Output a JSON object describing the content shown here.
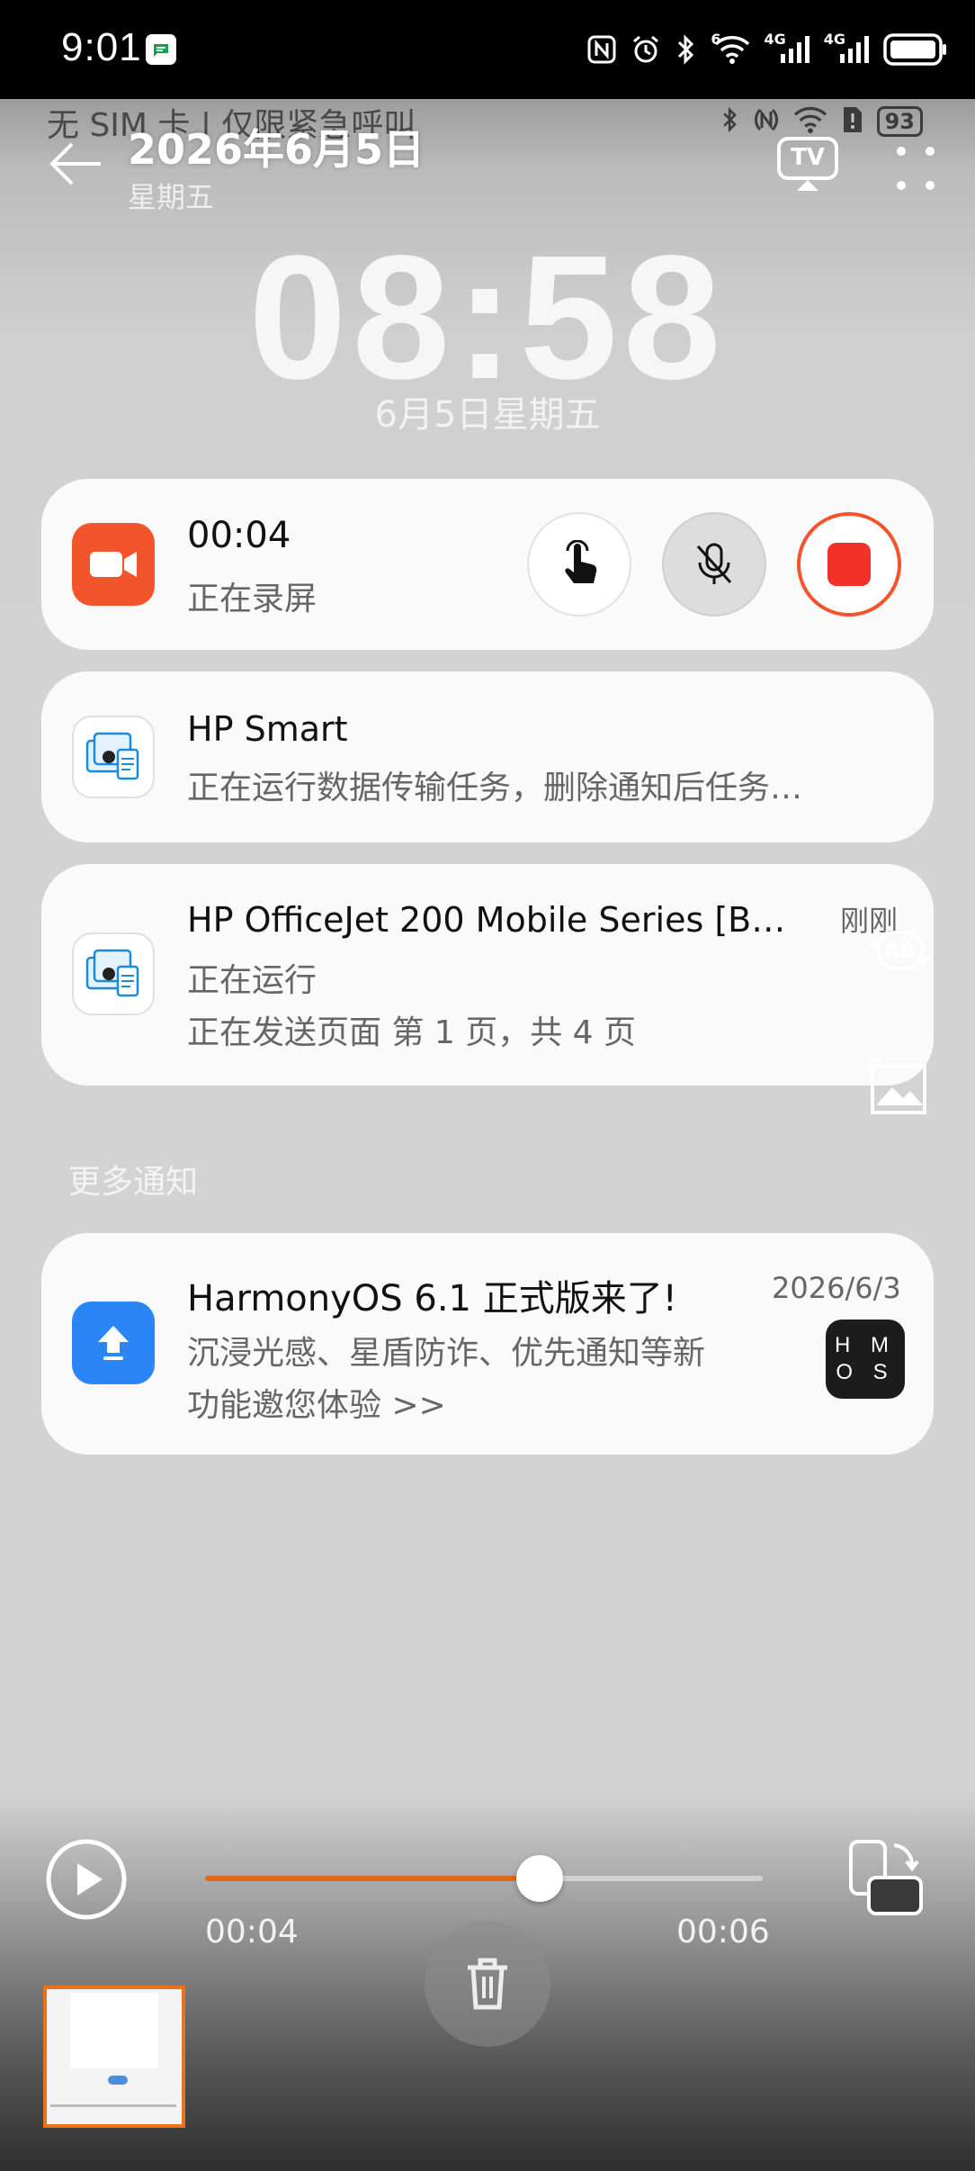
{
  "system_bar": {
    "time": "9:01",
    "battery": "",
    "icons": [
      "nfc-icon",
      "alarm-icon",
      "bluetooth-icon",
      "wifi-icon",
      "signal-4g-1-icon",
      "signal-4g-2-icon",
      "battery-icon"
    ],
    "wifi_label": "6",
    "net1_label": "4G",
    "net2_label": "4G"
  },
  "viewer": {
    "title": "2026年6月5日",
    "subtitle": "星期五",
    "tv_label": "TV"
  },
  "recording": {
    "status_text": "无 SIM 卡 | 仅限紧急呼叫",
    "battery": "93",
    "clock": "08:58",
    "date": "6月5日星期五"
  },
  "notifications": {
    "screen_record": {
      "time": "00:04",
      "label": "正在录屏"
    },
    "hp_smart": {
      "title": "HP Smart",
      "body": "正在运行数据传输任务，删除通知后任务…"
    },
    "hp_officejet": {
      "title": "HP OfficeJet 200 Mobile Series [B…",
      "time": "刚刚",
      "line1": "正在运行",
      "line2": "正在发送页面 第 1 页，共 4 页"
    },
    "more_label": "更多通知",
    "harmony": {
      "title": "HarmonyOS 6.1 正式版来了!",
      "date": "2026/6/3",
      "line1": "沉浸光感、星盾防诈、优先通知等新",
      "line2": "功能邀您体验 >>",
      "badge_top": "H M",
      "badge_bottom": "O S"
    }
  },
  "side_tools": {
    "translate_label": "AB"
  },
  "player": {
    "current": "00:04",
    "total": "00:06",
    "progress": 0.6,
    "accent": "#e06a1c"
  }
}
